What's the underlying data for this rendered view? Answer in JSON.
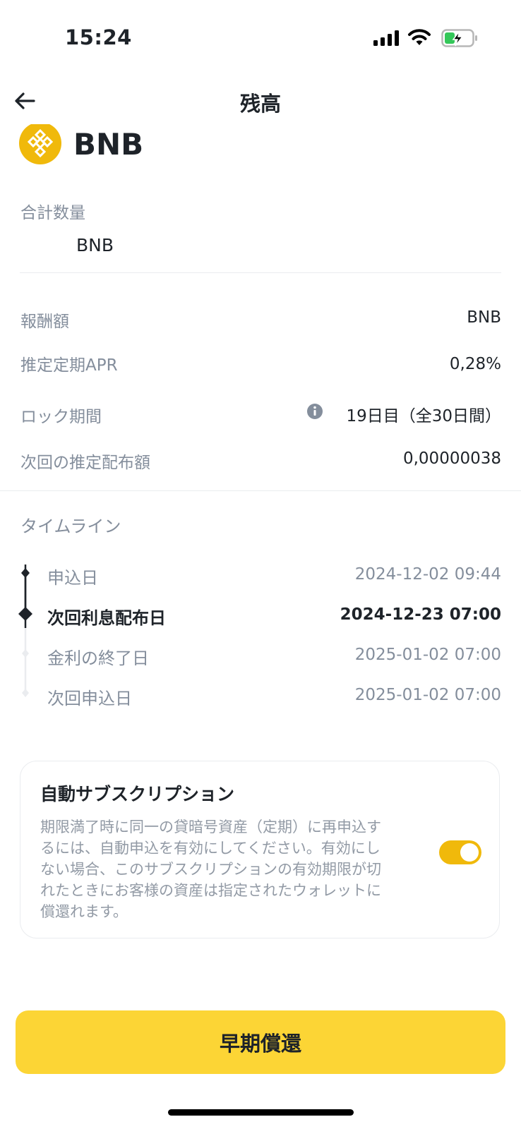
{
  "status_bar": {
    "time": "15:24"
  },
  "header": {
    "title": "残高"
  },
  "coin": {
    "name": "BNB"
  },
  "total": {
    "label": "合計数量",
    "unit": "BNB"
  },
  "details": [
    {
      "label": "報酬額",
      "value": "BNB"
    },
    {
      "label": "推定定期APR",
      "value": "0,28%"
    },
    {
      "label": "ロック期間",
      "value": "19日目（全30日間）"
    },
    {
      "label": "次回の推定配布額",
      "value": "0,00000038"
    }
  ],
  "timeline": {
    "title": "タイムライン",
    "items": [
      {
        "label": "申込日",
        "date": "2024-12-02 09:44"
      },
      {
        "label": "次回利息配布日",
        "date": "2024-12-23 07:00"
      },
      {
        "label": "金利の終了日",
        "date": "2025-01-02 07:00"
      },
      {
        "label": "次回申込日",
        "date": "2025-01-02 07:00"
      }
    ]
  },
  "auto_subscription": {
    "title": "自動サブスクリプション",
    "lines": [
      "期限満了時に同一の貸暗号資産（定期）に再申込す",
      "るには、自動申込を有効にしてください。有効にし",
      "ない場合、このサブスクリプションの有効期限が切",
      "れたときにお客様の資産は指定されたウォレットに",
      "償還れます。"
    ],
    "enabled": true
  },
  "actions": {
    "redeem_label": "早期償還"
  },
  "colors": {
    "accent": "#f0b90b",
    "button": "#fcd535",
    "text": "#1e2329",
    "muted": "#848e9c"
  }
}
